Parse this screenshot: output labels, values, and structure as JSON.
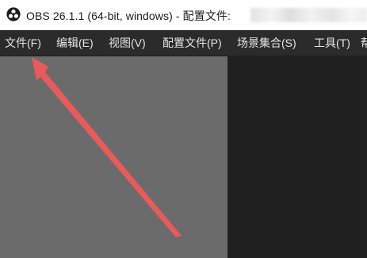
{
  "window": {
    "title": "OBS 26.1.1 (64-bit, windows) - 配置文件: "
  },
  "menubar": {
    "items": [
      {
        "label": "文件(F)"
      },
      {
        "label": "编辑(E)"
      },
      {
        "label": "视图(V)"
      },
      {
        "label": "配置文件(P)"
      },
      {
        "label": "场景集合(S)"
      },
      {
        "label": "工具(T)"
      },
      {
        "label": "帮助(H)"
      }
    ]
  },
  "colors": {
    "menubar_bg": "#2b2b2b",
    "preview_bg": "#6b6b6b",
    "canvas_bg": "#202020",
    "annotation_arrow": "#f05a5a"
  },
  "icons": {
    "app_logo": "obs-logo-icon",
    "annotation": "red-arrow-icon"
  }
}
